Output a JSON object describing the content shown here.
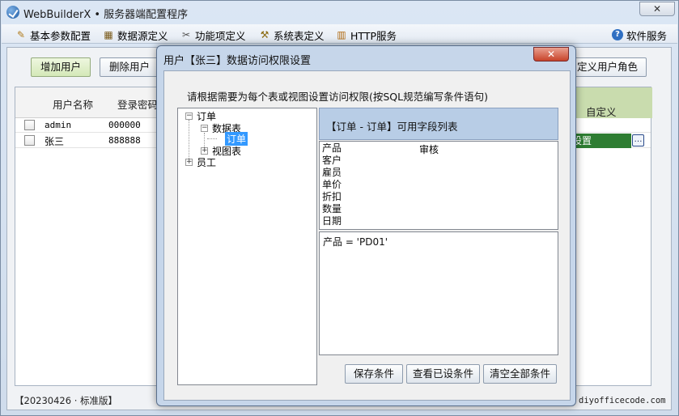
{
  "window": {
    "title": "WebBuilderX • 服务器端配置程序",
    "close_glyph": "✕"
  },
  "menu": {
    "items": [
      {
        "label": "基本参数配置",
        "icon": "✎"
      },
      {
        "label": "数据源定义",
        "icon": "▦"
      },
      {
        "label": "功能项定义",
        "icon": "✂"
      },
      {
        "label": "系统表定义",
        "icon": "⚒"
      },
      {
        "label": "HTTP服务",
        "icon": "▥"
      }
    ],
    "right_item": {
      "label": "软件服务",
      "icon": "?"
    }
  },
  "toolbar": {
    "add_user": "增加用户",
    "delete_user": "删除用户",
    "custom_role": "定义用户角色"
  },
  "grid": {
    "columns": [
      "用户名称",
      "登录密码",
      "自定义"
    ],
    "rows": [
      {
        "name": "admin",
        "password": "000000"
      },
      {
        "name": "张三",
        "password": "888888"
      }
    ],
    "set_label": "设置",
    "ellipsis": "…"
  },
  "status": {
    "left": "【20230426 · 标准版】",
    "right": "diyofficecode.com"
  },
  "dialog": {
    "title": "用户【张三】数据访问权限设置",
    "close_glyph": "✕",
    "hint": "请根据需要为每个表或视图设置访问权限(按SQL规范编写条件语句)",
    "tree": {
      "root": "订单",
      "tables_group": "数据表",
      "selected_table": "订单",
      "views_group": "视图表",
      "other_root": "员工",
      "minus": "−",
      "plus": "+"
    },
    "fields_title": "【订单 - 订单】可用字段列表",
    "fields": [
      "产品",
      "客户",
      "雇员",
      "单价",
      "折扣",
      "数量",
      "日期"
    ],
    "fields_extra": "审核",
    "condition": "产品 = 'PD01'",
    "buttons": {
      "save": "保存条件",
      "view": "查看已设条件",
      "clear": "清空全部条件"
    }
  }
}
